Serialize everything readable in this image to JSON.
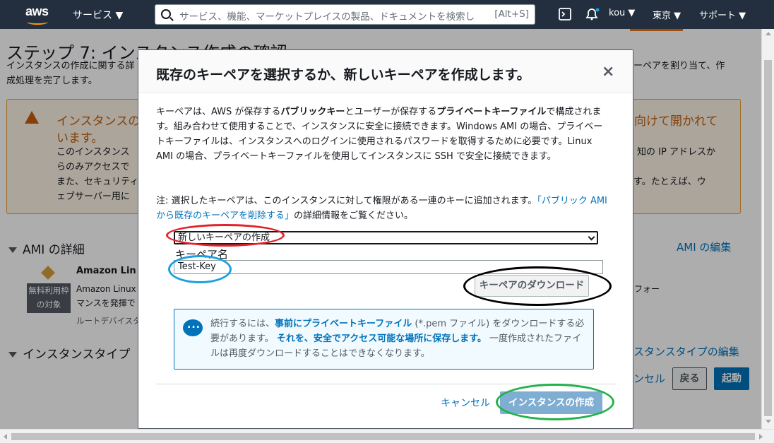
{
  "topbar": {
    "logo": "aws",
    "services": "サービス ▼",
    "search_placeholder": "サービス、機能、マーケットプレイスの製品、ドキュメントを検索し",
    "search_shortcut": "[Alt+S]",
    "user": "kou ▼",
    "region": "東京 ▼",
    "support": "サポート ▼",
    "icons": [
      "cloudshell-icon",
      "bell-icon"
    ]
  },
  "background": {
    "title": "ステップ 7: インスタンス作成の確認",
    "intro_line1": "インスタンスの作成に関する詳",
    "intro_line1_right": "ーペアを割り当て、作",
    "intro_line2": "成処理を完了します。",
    "warning_title": "インスタンスの",
    "warning_title_right": "向けて開かれて",
    "warning_title2": "います。",
    "warning_l1": "このインスタンス",
    "warning_l1_right": "知の IP アドレスか",
    "warning_l2": "らのみアクセスで",
    "warning_l3": "また、セキュリティ",
    "warning_l3_right": "す。たとえば、ウ",
    "warning_l4": "ェブサーバー用に",
    "ami_section": "AMI の詳細",
    "ami_edit": "AMI の編集",
    "ami_name": "Amazon Lin",
    "ami_desc1": "Amazon Linux",
    "ami_desc1_right": "フォー",
    "ami_desc2": "マンスを発揮で",
    "ami_desc3": "ルートデバイスタ",
    "free_tag": "無料利用枠の対象",
    "instance_section": "インスタンスタイプ",
    "instance_edit": "スタンスタイプの編集",
    "cancel_partial": "ンセル",
    "back": "戻る",
    "launch": "起動"
  },
  "modal": {
    "title": "既存のキーペアを選択するか、新しいキーペアを作成します。",
    "close": "×",
    "p1_a": "キーペアは、AWS が保存する",
    "p1_b": "パブリックキー",
    "p1_c": "とユーザーが保存する",
    "p1_d": "プライベートキーファイル",
    "p1_e": "で構成されます。組み合わせて使用することで、インスタンスに安全に接続できます。Windows AMI の場合、プライベートキーファイルは、インスタンスへのログインに使用されるパスワードを取得するために必要です。Linux AMI の場合、プライベートキーファイルを使用してインスタンスに SSH で安全に接続できます。",
    "note_a": "注: 選択したキーペアは、このインスタンスに対して権限がある一連のキーに追加されます。",
    "note_link": "「パブリック AMI から既存のキーペアを削除する」",
    "note_b": "の詳細情報をご覧ください。",
    "keypair_option": "新しいキーペアの作成",
    "keypair_name_label": "キーペア名",
    "keypair_name_value": "Test-Key",
    "download_button": "キーペアのダウンロード",
    "info_a": "続行するには、",
    "info_b": "事前にプライベートキーファイル",
    "info_c": "(*.pem ファイル) をダウンロードする必要があります。",
    "info_d": "それを、安全でアクセス可能な場所に保存します。",
    "info_e": "一度作成されたファイルは再度ダウンロードすることはできなくなります。",
    "cancel": "キャンセル",
    "create": "インスタンスの作成"
  },
  "annotations": {
    "red": "#e3202a",
    "blue": "#1ca0e0",
    "black": "#000000",
    "green": "#22b24c"
  }
}
